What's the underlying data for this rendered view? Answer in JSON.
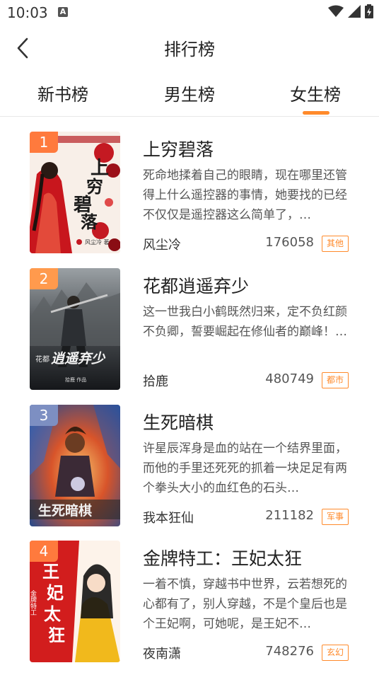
{
  "status": {
    "time": "10:03",
    "notification_glyph": "A"
  },
  "header": {
    "title": "排行榜"
  },
  "tabs": [
    {
      "label": "新书榜",
      "active": false
    },
    {
      "label": "男生榜",
      "active": false
    },
    {
      "label": "女生榜",
      "active": true
    }
  ],
  "colors": {
    "accent": "#ff8a2b"
  },
  "books": [
    {
      "rank": "1",
      "rank_color": "#ff7a3d",
      "title": "上穷碧落",
      "desc": "死命地揉着自己的眼睛，现在哪里还管得上什么遥控器的事情，她要找的已经不仅仅是遥控器这么简单了，…",
      "author": "风尘冷",
      "count": "176058",
      "tag": "其他",
      "cover_text": "上穷碧落",
      "cover_author": "风尘冷 著"
    },
    {
      "rank": "2",
      "rank_color": "#ff9a4d",
      "title": "花都逍遥弃少",
      "desc": "这一世我白小鹤既然归来，定不负红颜不负卿，誓要崛起在修仙者的巅峰！…",
      "author": "拾鹿",
      "count": "480749",
      "tag": "都市",
      "cover_text": "逍遥弃少",
      "cover_small": "花都",
      "cover_author": "拾鹿 作品"
    },
    {
      "rank": "3",
      "rank_color": "#7d8fc2",
      "title": "生死暗棋",
      "desc": "许星辰浑身是血的站在一个结界里面，而他的手里还死死的抓着一块足足有两个拳头大小的血红色的石头…",
      "author": "我本狂仙",
      "count": "211182",
      "tag": "军事",
      "cover_text": "生死暗棋"
    },
    {
      "rank": "4",
      "rank_color": "#ff7a3d",
      "title": "金牌特工：王妃太狂",
      "desc": "一着不慎，穿越书中世界，云若想死的心都有了，别人穿越，不是个皇后也是个王妃啊，可她呢，是王妃不…",
      "author": "夜南潇",
      "count": "748276",
      "tag": "玄幻",
      "cover_text": "王妃太狂",
      "cover_small": "金牌特工"
    }
  ]
}
